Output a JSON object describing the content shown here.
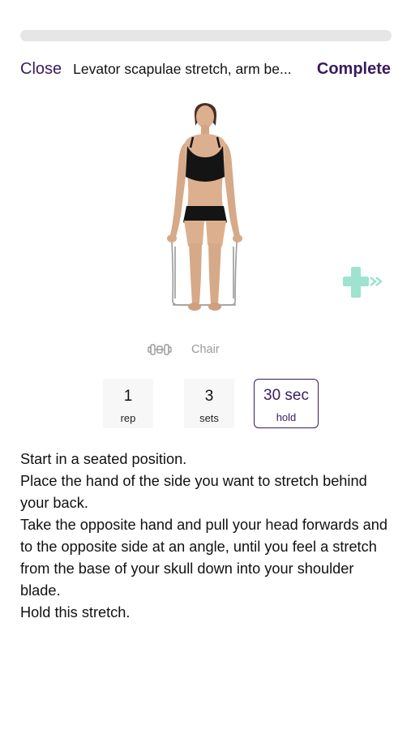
{
  "header": {
    "close_label": "Close",
    "title": "Levator scapulae stretch, arm be...",
    "complete_label": "Complete"
  },
  "colors": {
    "accent": "#3a1b5e",
    "next_icon": "#9de3d0",
    "muted": "#9a9a9a"
  },
  "illustration": {
    "icon": "seated-woman-on-chair-photo"
  },
  "next_button": {
    "icon": "plus-arrow-icon"
  },
  "equipment": {
    "icon": "dumbbell-icon",
    "label": "Chair"
  },
  "stats": [
    {
      "value": "1",
      "unit": "rep"
    },
    {
      "value": "3",
      "unit": "sets"
    },
    {
      "value": "30 sec",
      "unit": "hold"
    }
  ],
  "instructions": [
    "Start in a seated position.",
    "Place the hand of the side you want to stretch behind your back.",
    "Take the opposite hand and pull your head forwards and to the opposite side at an angle, until you feel a stretch from the base of your skull down into your shoulder blade.",
    "Hold this stretch."
  ]
}
